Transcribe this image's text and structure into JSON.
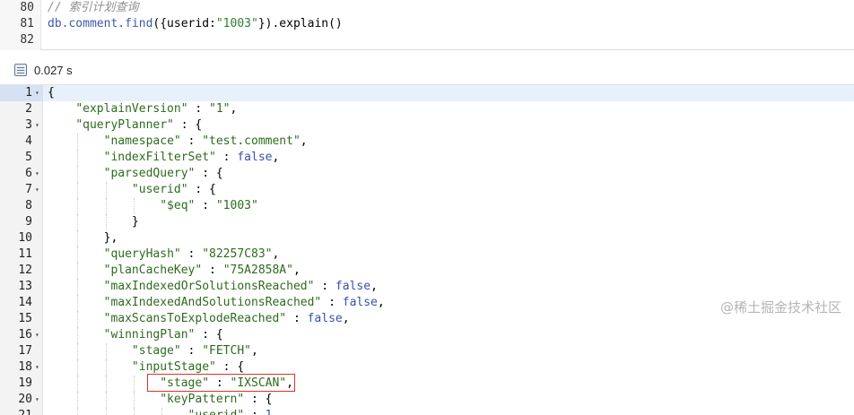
{
  "editor": {
    "lines": [
      {
        "num": "80",
        "text": "// 索引计划查询"
      },
      {
        "num": "81",
        "text": "db.comment.find({userid:\"1003\"}).explain()"
      },
      {
        "num": "82",
        "text": ""
      }
    ]
  },
  "status": {
    "elapsed": "0.027 s",
    "icon": "timer-icon"
  },
  "result": {
    "lines": [
      {
        "num": "1",
        "fold": true,
        "text": "{"
      },
      {
        "num": "2",
        "fold": false,
        "text": "    \"explainVersion\" : \"1\","
      },
      {
        "num": "3",
        "fold": true,
        "text": "    \"queryPlanner\" : {"
      },
      {
        "num": "4",
        "fold": false,
        "text": "        \"namespace\" : \"test.comment\","
      },
      {
        "num": "5",
        "fold": false,
        "text": "        \"indexFilterSet\" : false,"
      },
      {
        "num": "6",
        "fold": true,
        "text": "        \"parsedQuery\" : {"
      },
      {
        "num": "7",
        "fold": true,
        "text": "            \"userid\" : {"
      },
      {
        "num": "8",
        "fold": false,
        "text": "                \"$eq\" : \"1003\""
      },
      {
        "num": "9",
        "fold": false,
        "text": "            }"
      },
      {
        "num": "10",
        "fold": false,
        "text": "        },"
      },
      {
        "num": "11",
        "fold": false,
        "text": "        \"queryHash\" : \"82257C83\","
      },
      {
        "num": "12",
        "fold": false,
        "text": "        \"planCacheKey\" : \"75A2858A\","
      },
      {
        "num": "13",
        "fold": false,
        "text": "        \"maxIndexedOrSolutionsReached\" : false,"
      },
      {
        "num": "14",
        "fold": false,
        "text": "        \"maxIndexedAndSolutionsReached\" : false,"
      },
      {
        "num": "15",
        "fold": false,
        "text": "        \"maxScansToExplodeReached\" : false,"
      },
      {
        "num": "16",
        "fold": true,
        "text": "        \"winningPlan\" : {"
      },
      {
        "num": "17",
        "fold": false,
        "text": "            \"stage\" : \"FETCH\","
      },
      {
        "num": "18",
        "fold": true,
        "text": "            \"inputStage\" : {"
      },
      {
        "num": "19",
        "fold": false,
        "text": "                \"stage\" : \"IXSCAN\","
      },
      {
        "num": "20",
        "fold": true,
        "text": "                \"keyPattern\" : {"
      },
      {
        "num": "21",
        "fold": false,
        "text": "                    \"userid\" : 1"
      }
    ]
  },
  "watermark": "@稀土掘金技术社区",
  "colors": {
    "key": "#2e6b1f",
    "keyword": "#3b4fb0",
    "highlight_border": "#d9342b",
    "active_line": "#e8f0fb"
  }
}
